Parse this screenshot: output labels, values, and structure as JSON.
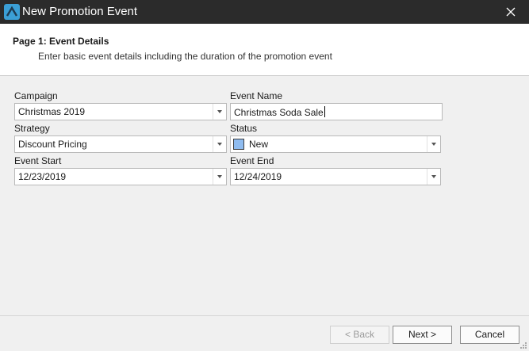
{
  "window": {
    "title": "New Promotion Event",
    "icon": "app-logo-icon",
    "close_icon": "close-icon"
  },
  "header": {
    "page_title": "Page 1: Event Details",
    "subtitle": "Enter basic event details including the duration of the promotion event"
  },
  "form": {
    "campaign": {
      "label": "Campaign",
      "value": "Christmas 2019"
    },
    "event_name": {
      "label": "Event Name",
      "value": "Christmas Soda Sale"
    },
    "strategy": {
      "label": "Strategy",
      "value": "Discount Pricing"
    },
    "status": {
      "label": "Status",
      "value": "New",
      "swatch_color": "#8fbcf0"
    },
    "event_start": {
      "label": "Event Start",
      "value": "12/23/2019"
    },
    "event_end": {
      "label": "Event End",
      "value": "12/24/2019"
    }
  },
  "footer": {
    "back_label": "< Back",
    "next_label": "Next >",
    "cancel_label": "Cancel"
  }
}
